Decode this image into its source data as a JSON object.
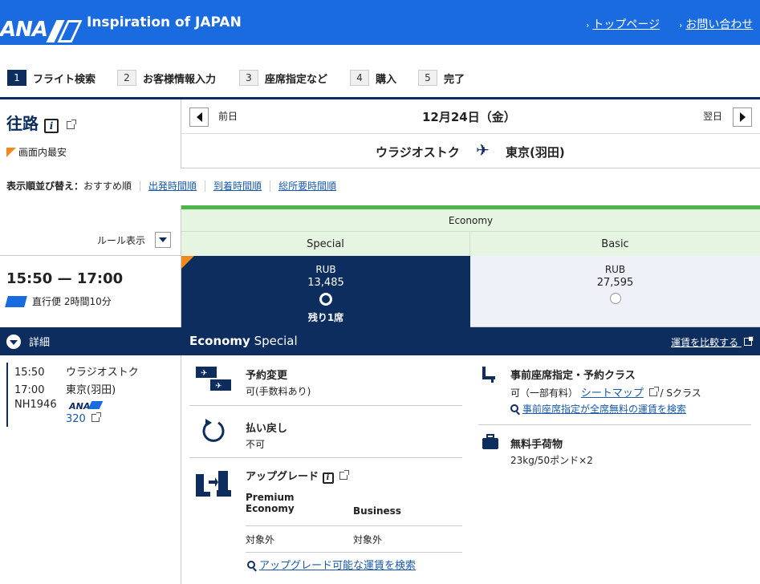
{
  "header": {
    "logo_text": "ANA",
    "tagline": "Inspiration of JAPAN",
    "links": [
      {
        "label": "トップページ"
      },
      {
        "label": "お問い合わせ"
      }
    ]
  },
  "steps": [
    {
      "num": "1",
      "label": "フライト検索",
      "active": true
    },
    {
      "num": "2",
      "label": "お客様情報入力"
    },
    {
      "num": "3",
      "label": "座席指定など"
    },
    {
      "num": "4",
      "label": "購入"
    },
    {
      "num": "5",
      "label": "完了"
    }
  ],
  "outbound": {
    "title": "往路",
    "info_glyph": "i",
    "cheapest_label": "画面内最安",
    "prev_label": "前日",
    "next_label": "翌日",
    "date": "12月24日（金）",
    "from": "ウラジオストク",
    "to": "東京(羽田)"
  },
  "sort": {
    "label": "表示順並び替え：",
    "current": "おすすめ順",
    "options": [
      "出発時間順",
      "到着時間順",
      "総所要時間順"
    ]
  },
  "fare_table": {
    "rules_label": "ルール表示",
    "cabin": "Economy",
    "columns": [
      "Special",
      "Basic"
    ]
  },
  "flight": {
    "times": "15:50 — 17:00",
    "direct": "直行便 2時間10分",
    "special": {
      "currency": "RUB",
      "amount": "13,485",
      "remaining": "残り1席",
      "selected": true
    },
    "basic": {
      "currency": "RUB",
      "amount": "27,595",
      "selected": false
    }
  },
  "detail": {
    "toggle_label": "詳細",
    "fare_name_bold": "Economy",
    "fare_name_rest": " Special",
    "compare_label": "運賃を比較する",
    "segment": {
      "dep_time": "15:50",
      "dep_city": "ウラジオストク",
      "arr_time": "17:00",
      "arr_city": "東京(羽田)",
      "flight_no": "NH1946",
      "airline_logo": "ANA",
      "aircraft": "320"
    },
    "rules": {
      "change_title": "予約変更",
      "change_val": "可(手数料あり)",
      "refund_title": "払い戻し",
      "refund_val": "不可",
      "upgrade_title": "アップグレード",
      "upgrade_col1": "Premium\nEconomy",
      "upgrade_col2": "Business",
      "upgrade_val1": "対象外",
      "upgrade_val2": "対象外",
      "upgrade_search": "アップグレード可能な運賃を検索",
      "seat_title": "事前座席指定・予約クラス",
      "seat_val_prefix": "可（一部有料）",
      "seat_map": "シートマップ",
      "seat_class": " / Sクラス",
      "seat_search": "事前座席指定が全席無料の運賃を検索",
      "baggage_title": "無料手荷物",
      "baggage_val": "23kg/50ポンド×2"
    }
  }
}
